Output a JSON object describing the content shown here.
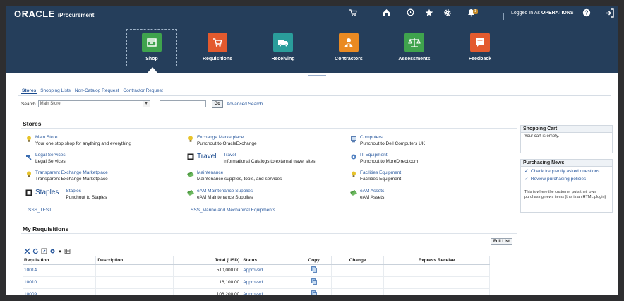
{
  "header": {
    "logo": "ORACLE",
    "app_name": "iProcurement",
    "notification_count": "1",
    "logged_in_prefix": "Logged In As",
    "logged_in_user": "OPERATIONS"
  },
  "nav": [
    {
      "label": "Shop",
      "color": "#3fa34d",
      "icon": "shop-icon",
      "selected": true
    },
    {
      "label": "Requisitions",
      "color": "#e35a2e",
      "icon": "cart-icon"
    },
    {
      "label": "Receiving",
      "color": "#2a9d9b",
      "icon": "truck-icon"
    },
    {
      "label": "Contractors",
      "color": "#ea8a22",
      "icon": "contractor-icon"
    },
    {
      "label": "Assessments",
      "color": "#3fa34d",
      "icon": "scales-icon"
    },
    {
      "label": "Feedback",
      "color": "#e35a2e",
      "icon": "feedback-icon"
    }
  ],
  "tabs": [
    "Stores",
    "Shopping Lists",
    "Non-Catalog Request",
    "Contractor Request"
  ],
  "search": {
    "label": "Search",
    "selected_store": "Main Store",
    "go_label": "Go",
    "advanced_label": "Advanced Search"
  },
  "stores_title": "Stores",
  "stores": [
    {
      "name": "Main Store",
      "desc": "Your one stop shop for anything and everything"
    },
    {
      "name": "Exchange Marketplace",
      "desc": "Punchout to OracleExchange"
    },
    {
      "name": "Computers",
      "desc": "Punchout to Dell Computers UK"
    },
    {
      "name": "Legal Services",
      "desc": "Legal Services"
    },
    {
      "big": "Travel",
      "name": "Travel",
      "desc": "Informational Catalogs to external travel sites."
    },
    {
      "name": "IT Equipment",
      "desc": "Punchout to MoreDirect.com"
    },
    {
      "name": "Transparent Exchange Marketplace",
      "desc": "Transparent Exchange Marketplace"
    },
    {
      "name": "Maintenance",
      "desc": "Maintenance supplies, tools, and services"
    },
    {
      "name": "Facilities Equipment",
      "desc": "Facilities Equipment"
    },
    {
      "big": "Staples",
      "name": "Staples",
      "desc": "Punchout to Staples"
    },
    {
      "name": "eAM Maintenance Supplies",
      "desc": "eAM Maintenance Supplies"
    },
    {
      "name": "eAM Assets",
      "desc": "eAM Assets"
    },
    {
      "name": "SSS_TEST",
      "desc": ""
    },
    {
      "name": "SSS_Marine and Mechanical Equipments",
      "desc": ""
    }
  ],
  "cart": {
    "title": "Shopping Cart",
    "empty": "Your cart is empty."
  },
  "news": {
    "title": "Purchasing News",
    "items": [
      "Check frequently asked questions",
      "Review purchasing policies"
    ],
    "note": "This is where the customer puts their own purchasing news items (this is an HTML plugin)"
  },
  "requisitions": {
    "title": "My Requisitions",
    "full_list_label": "Full List",
    "columns": [
      "Requisition",
      "Description",
      "Total (USD)",
      "Status",
      "Copy",
      "Change",
      "Express Receive"
    ],
    "rows": [
      {
        "req": "10014",
        "desc": "",
        "total": "510,000.00",
        "status": "Approved"
      },
      {
        "req": "10010",
        "desc": "",
        "total": "16,100.00",
        "status": "Approved"
      },
      {
        "req": "10009",
        "desc": "",
        "total": "106,200.00",
        "status": "Approved"
      }
    ]
  }
}
